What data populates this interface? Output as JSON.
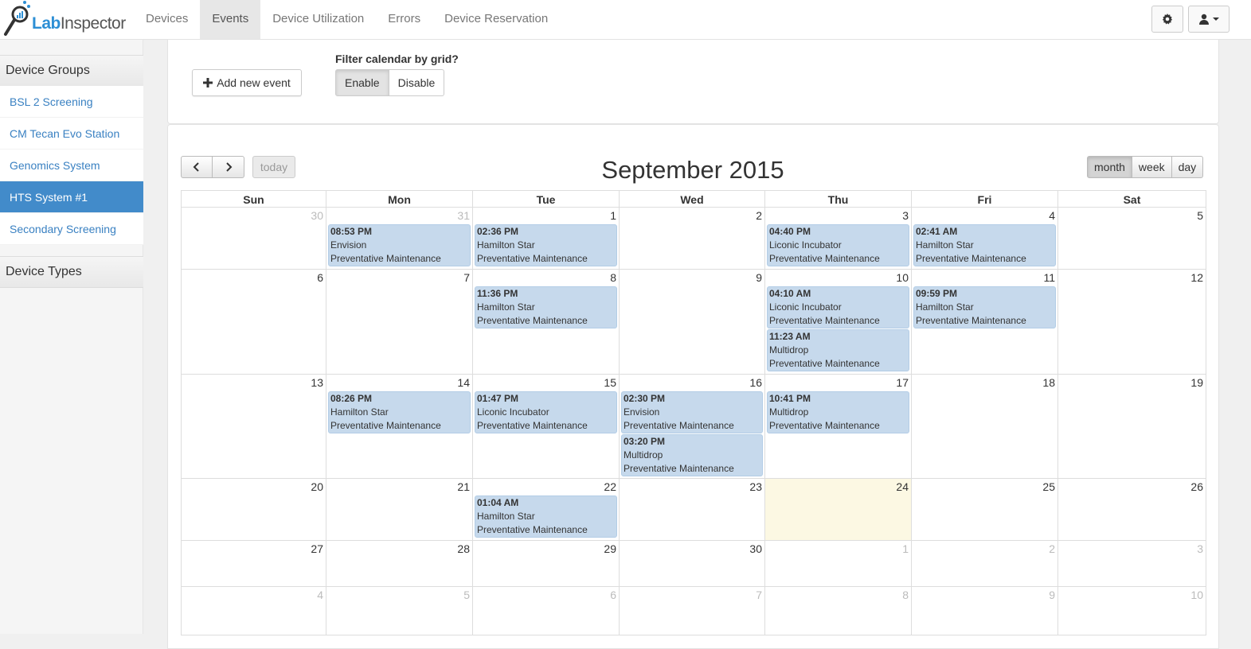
{
  "brand": {
    "lab": "Lab",
    "inspector": "Inspector"
  },
  "nav": {
    "items": [
      {
        "label": "Devices",
        "active": false
      },
      {
        "label": "Events",
        "active": true
      },
      {
        "label": "Device Utilization",
        "active": false
      },
      {
        "label": "Errors",
        "active": false
      },
      {
        "label": "Device Reservation",
        "active": false
      }
    ]
  },
  "sidebar": {
    "groups_title": "Device Groups",
    "types_title": "Device Types",
    "items": [
      {
        "label": "BSL 2 Screening",
        "active": false
      },
      {
        "label": "CM Tecan Evo Station",
        "active": false
      },
      {
        "label": "Genomics System",
        "active": false
      },
      {
        "label": "HTS System #1",
        "active": true
      },
      {
        "label": "Secondary Screening",
        "active": false
      }
    ]
  },
  "toolbar": {
    "add_label": "Add new event",
    "filter_label": "Filter calendar by grid?",
    "enable_label": "Enable",
    "disable_label": "Disable"
  },
  "calendar": {
    "title": "September 2015",
    "today_label": "today",
    "views": [
      {
        "label": "month",
        "active": true
      },
      {
        "label": "week",
        "active": false
      },
      {
        "label": "day",
        "active": false
      }
    ],
    "weekdays": [
      "Sun",
      "Mon",
      "Tue",
      "Wed",
      "Thu",
      "Fri",
      "Sat"
    ],
    "weeks": [
      [
        {
          "d": "30",
          "o": true
        },
        {
          "d": "31",
          "o": true
        },
        {
          "d": "1"
        },
        {
          "d": "2"
        },
        {
          "d": "3"
        },
        {
          "d": "4"
        },
        {
          "d": "5"
        }
      ],
      [
        {
          "d": "6"
        },
        {
          "d": "7"
        },
        {
          "d": "8"
        },
        {
          "d": "9"
        },
        {
          "d": "10"
        },
        {
          "d": "11"
        },
        {
          "d": "12"
        }
      ],
      [
        {
          "d": "13"
        },
        {
          "d": "14"
        },
        {
          "d": "15"
        },
        {
          "d": "16"
        },
        {
          "d": "17"
        },
        {
          "d": "18"
        },
        {
          "d": "19"
        }
      ],
      [
        {
          "d": "20"
        },
        {
          "d": "21"
        },
        {
          "d": "22"
        },
        {
          "d": "23"
        },
        {
          "d": "24",
          "today": true
        },
        {
          "d": "25"
        },
        {
          "d": "26"
        }
      ],
      [
        {
          "d": "27"
        },
        {
          "d": "28"
        },
        {
          "d": "29"
        },
        {
          "d": "30"
        },
        {
          "d": "1",
          "o": true
        },
        {
          "d": "2",
          "o": true
        },
        {
          "d": "3",
          "o": true
        }
      ],
      [
        {
          "d": "4",
          "o": true
        },
        {
          "d": "5",
          "o": true
        },
        {
          "d": "6",
          "o": true
        },
        {
          "d": "7",
          "o": true
        },
        {
          "d": "8",
          "o": true
        },
        {
          "d": "9",
          "o": true
        },
        {
          "d": "10",
          "o": true
        }
      ]
    ],
    "events": [
      {
        "week": 0,
        "day": 1,
        "slot": 0,
        "time": "08:53 PM",
        "device": "Envision",
        "type": "Preventative Maintenance"
      },
      {
        "week": 0,
        "day": 2,
        "slot": 0,
        "time": "02:36 PM",
        "device": "Hamilton Star",
        "type": "Preventative Maintenance"
      },
      {
        "week": 0,
        "day": 4,
        "slot": 0,
        "time": "04:40 PM",
        "device": "Liconic Incubator",
        "type": "Preventative Maintenance"
      },
      {
        "week": 0,
        "day": 5,
        "slot": 0,
        "time": "02:41 AM",
        "device": "Hamilton Star",
        "type": "Preventative Maintenance"
      },
      {
        "week": 1,
        "day": 2,
        "slot": 0,
        "time": "11:36 PM",
        "device": "Hamilton Star",
        "type": "Preventative Maintenance"
      },
      {
        "week": 1,
        "day": 4,
        "slot": 0,
        "time": "04:10 AM",
        "device": "Liconic Incubator",
        "type": "Preventative Maintenance"
      },
      {
        "week": 1,
        "day": 4,
        "slot": 1,
        "time": "11:23 AM",
        "device": "Multidrop",
        "type": "Preventative Maintenance"
      },
      {
        "week": 1,
        "day": 5,
        "slot": 0,
        "time": "09:59 PM",
        "device": "Hamilton Star",
        "type": "Preventative Maintenance"
      },
      {
        "week": 2,
        "day": 1,
        "slot": 0,
        "time": "08:26 PM",
        "device": "Hamilton Star",
        "type": "Preventative Maintenance"
      },
      {
        "week": 2,
        "day": 2,
        "slot": 0,
        "time": "01:47 PM",
        "device": "Liconic Incubator",
        "type": "Preventative Maintenance"
      },
      {
        "week": 2,
        "day": 3,
        "slot": 0,
        "time": "02:30 PM",
        "device": "Envision",
        "type": "Preventative Maintenance"
      },
      {
        "week": 2,
        "day": 3,
        "slot": 1,
        "time": "03:20 PM",
        "device": "Multidrop",
        "type": "Preventative Maintenance"
      },
      {
        "week": 2,
        "day": 4,
        "slot": 0,
        "time": "10:41 PM",
        "device": "Multidrop",
        "type": "Preventative Maintenance"
      },
      {
        "week": 3,
        "day": 2,
        "slot": 0,
        "time": "01:04 AM",
        "device": "Hamilton Star",
        "type": "Preventative Maintenance"
      }
    ]
  },
  "colors": {
    "event_bg": "#c6d9ec",
    "today_bg": "#fcf8e3",
    "sidebar_active": "#428bca",
    "link": "#3a81c2"
  },
  "icons": {
    "brand": "magnifier-logo-icon",
    "settings": "gear-icon",
    "user": "user-icon",
    "add": "plus-icon",
    "prev": "chevron-left-icon",
    "next": "chevron-right-icon"
  }
}
